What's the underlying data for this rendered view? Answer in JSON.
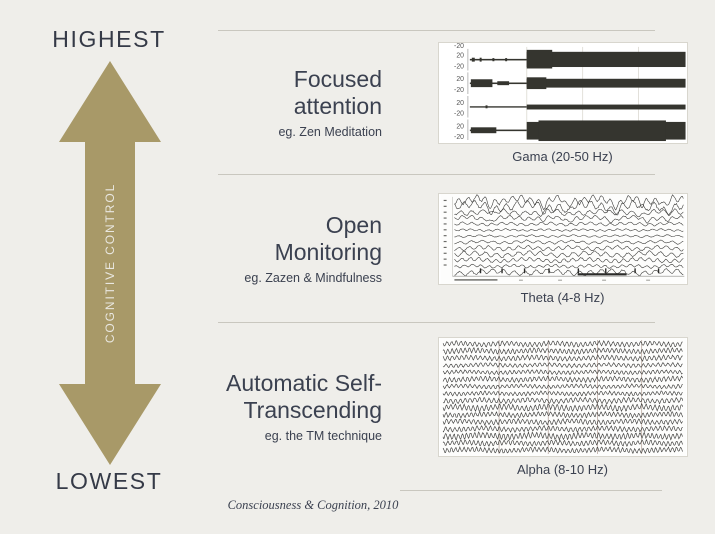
{
  "colors": {
    "background": "#efeeea",
    "arrow": "#a89968",
    "text_dark": "#3b4150",
    "divider": "#c9c7bf",
    "trace": "#3a3a38",
    "plot_bg": "#ffffff"
  },
  "axis": {
    "top_label": "HIGHEST",
    "bottom_label": "LOWEST",
    "vertical_label": "COGNITIVE CONTROL"
  },
  "rows": [
    {
      "title": "Focused\nattention",
      "subtitle": "eg. Zen Meditation",
      "caption": "Gama (20-50 Hz)",
      "band": "gamma",
      "y_tick_labels": [
        "20",
        "-20"
      ]
    },
    {
      "title": "Open\nMonitoring",
      "subtitle": "eg. Zazen & Mindfulness",
      "caption": "Theta (4-8 Hz)",
      "band": "theta",
      "y_tick_labels": []
    },
    {
      "title": "Automatic Self-\nTranscending",
      "subtitle": "eg. the TM technique",
      "caption": "Alpha (8-10 Hz)",
      "band": "alpha",
      "y_tick_labels": []
    }
  ],
  "footer": {
    "citation": "Consciousness & Cognition, 2010"
  },
  "chart_data": [
    {
      "type": "line",
      "title": "Gama (20-50 Hz)",
      "xlabel": "",
      "ylabel": "",
      "ylim": [
        -20,
        20
      ],
      "yticks": [
        20,
        -20
      ],
      "channels": 4,
      "description": "Four gamma-band EEG channels; low-amplitude baseline for first third then sustained high-amplitude burst",
      "onset_fraction": 0.33,
      "series": [
        {
          "name": "ch1",
          "baseline_amplitude": 2,
          "burst_amplitude": 16
        },
        {
          "name": "ch2",
          "baseline_amplitude": 5,
          "burst_amplitude": 10
        },
        {
          "name": "ch3",
          "baseline_amplitude": 1,
          "burst_amplitude": 5
        },
        {
          "name": "ch4",
          "baseline_amplitude": 4,
          "burst_amplitude": 18
        }
      ]
    },
    {
      "type": "line",
      "title": "Theta (4-8 Hz)",
      "xlabel": "",
      "ylabel": "",
      "channels": 13,
      "description": "Multichannel theta EEG montage with slow 4-8 Hz waves, prominent downward deflections on upper channels and an event marker bar on the bottom trace",
      "series": [
        {
          "name": "ch1",
          "amplitude": 7
        },
        {
          "name": "ch2",
          "amplitude": 8
        },
        {
          "name": "ch3",
          "amplitude": 5
        },
        {
          "name": "ch4",
          "amplitude": 4
        },
        {
          "name": "ch5",
          "amplitude": 3
        },
        {
          "name": "ch6",
          "amplitude": 2
        },
        {
          "name": "ch7",
          "amplitude": 2
        },
        {
          "name": "ch8",
          "amplitude": 3
        },
        {
          "name": "ch9",
          "amplitude": 4
        },
        {
          "name": "ch10",
          "amplitude": 5
        },
        {
          "name": "ch11",
          "amplitude": 4
        },
        {
          "name": "ch12",
          "amplitude": 3
        },
        {
          "name": "ch13",
          "amplitude": 5
        }
      ]
    },
    {
      "type": "line",
      "title": "Alpha (8-10 Hz)",
      "xlabel": "",
      "ylabel": "",
      "channels": 16,
      "description": "Sixteen-channel alpha EEG montage showing continuous 8-10 Hz sinusoidal rhythm across all traces with vertical second markers",
      "series": [
        {
          "name": "ch1",
          "amplitude": 5
        },
        {
          "name": "ch2",
          "amplitude": 5
        },
        {
          "name": "ch3",
          "amplitude": 5
        },
        {
          "name": "ch4",
          "amplitude": 4
        },
        {
          "name": "ch5",
          "amplitude": 4
        },
        {
          "name": "ch6",
          "amplitude": 5
        },
        {
          "name": "ch7",
          "amplitude": 4
        },
        {
          "name": "ch8",
          "amplitude": 4
        },
        {
          "name": "ch9",
          "amplitude": 5
        },
        {
          "name": "ch10",
          "amplitude": 6
        },
        {
          "name": "ch11",
          "amplitude": 5
        },
        {
          "name": "ch12",
          "amplitude": 5
        },
        {
          "name": "ch13",
          "amplitude": 5
        },
        {
          "name": "ch14",
          "amplitude": 6
        },
        {
          "name": "ch15",
          "amplitude": 5
        },
        {
          "name": "ch16",
          "amplitude": 5
        }
      ]
    }
  ]
}
